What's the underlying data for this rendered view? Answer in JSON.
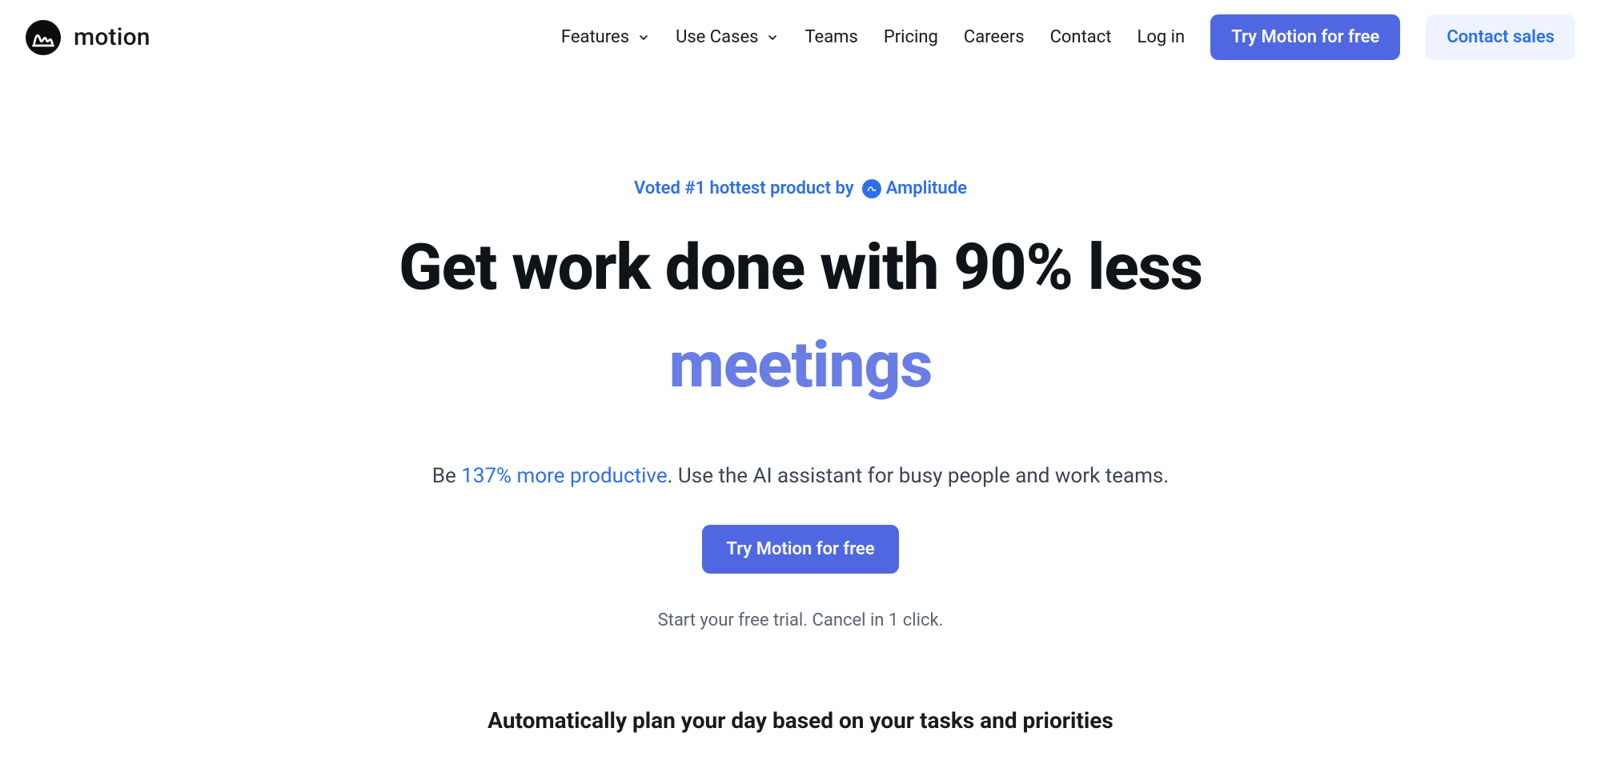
{
  "brand": {
    "name": "motion"
  },
  "nav": {
    "features": "Features",
    "use_cases": "Use Cases",
    "teams": "Teams",
    "pricing": "Pricing",
    "careers": "Careers",
    "contact": "Contact",
    "log_in": "Log in",
    "try_free": "Try Motion for free",
    "contact_sales": "Contact sales"
  },
  "hero": {
    "voted_prefix": "Voted #1 hottest product by",
    "voted_by_name": "Amplitude",
    "headline_line1": "Get work done with 90% less",
    "headline_line2": "meetings",
    "sub_prefix": "Be ",
    "sub_highlight": "137% more productive",
    "sub_suffix": ". Use the AI assistant for busy people and work teams.",
    "cta": "Try Motion for free",
    "trial_note": "Start your free trial. Cancel in 1 click.",
    "tagline": "Automatically plan your day based on your tasks and priorities"
  },
  "colors": {
    "primary": "#4f68e2",
    "link": "#2d6fe8",
    "secondary_bg": "#eef3ff",
    "accent_text": "#6a7de5"
  }
}
